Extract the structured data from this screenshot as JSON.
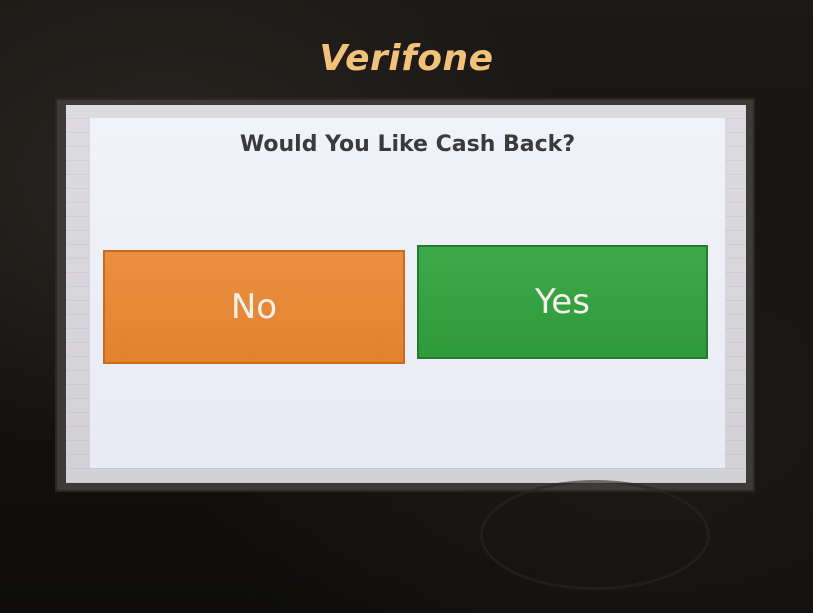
{
  "device": {
    "brand": "Verifone"
  },
  "prompt": {
    "title": "Would You Like Cash Back?",
    "no_label": "No",
    "yes_label": "Yes"
  },
  "colors": {
    "no_button": "#e3822e",
    "yes_button": "#2d9a3b",
    "brand": "#f3c27a"
  }
}
